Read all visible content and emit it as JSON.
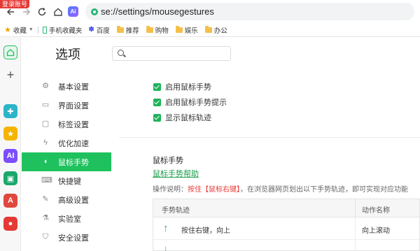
{
  "browser": {
    "login_tag": "登录账号",
    "url": "se://settings/mousegestures",
    "ai_badge": "Ai"
  },
  "bookmarks": [
    {
      "label": "收藏",
      "icon": "star-icon"
    },
    {
      "label": "手机收藏夹",
      "icon": "phone-icon"
    },
    {
      "label": "百度",
      "icon": "baidu-paw-icon"
    },
    {
      "label": "推荐",
      "icon": "folder-icon"
    },
    {
      "label": "购物",
      "icon": "folder-icon"
    },
    {
      "label": "娱乐",
      "icon": "folder-icon"
    },
    {
      "label": "办公",
      "icon": "folder-icon"
    }
  ],
  "settings": {
    "title": "选项",
    "menu": [
      {
        "label": "基本设置",
        "icon": "gear-icon"
      },
      {
        "label": "界面设置",
        "icon": "window-icon"
      },
      {
        "label": "标签设置",
        "icon": "tab-icon"
      },
      {
        "label": "优化加速",
        "icon": "lightning-icon"
      },
      {
        "label": "鼠标手势",
        "icon": "mouse-icon",
        "active": true
      },
      {
        "label": "快捷键",
        "icon": "keyboard-icon"
      },
      {
        "label": "高级设置",
        "icon": "wrench-icon"
      },
      {
        "label": "实验室",
        "icon": "flask-icon"
      },
      {
        "label": "安全设置",
        "icon": "shield-icon"
      }
    ],
    "checkboxes": [
      {
        "label": "启用鼠标手势",
        "checked": true
      },
      {
        "label": "启用鼠标手势提示",
        "checked": true
      },
      {
        "label": "显示鼠标轨迹",
        "checked": true
      }
    ],
    "section_title": "鼠标手势",
    "help_link": "鼠标手势帮助",
    "desc_prefix": "操作说明：",
    "desc_warn": "按住【鼠标右键】",
    "desc_suffix": "，在浏览器网页划出以下手势轨迹，即可实现对应功能",
    "table": {
      "headers": [
        "手势轨迹",
        "动作名称"
      ],
      "rows": [
        {
          "arrow": "↑",
          "gesture": "按住右键，向上",
          "action": "向上滚动"
        }
      ]
    }
  },
  "colors": {
    "accent": "#1fc15e",
    "warn": "#e53935",
    "link": "#1a9e4a"
  }
}
